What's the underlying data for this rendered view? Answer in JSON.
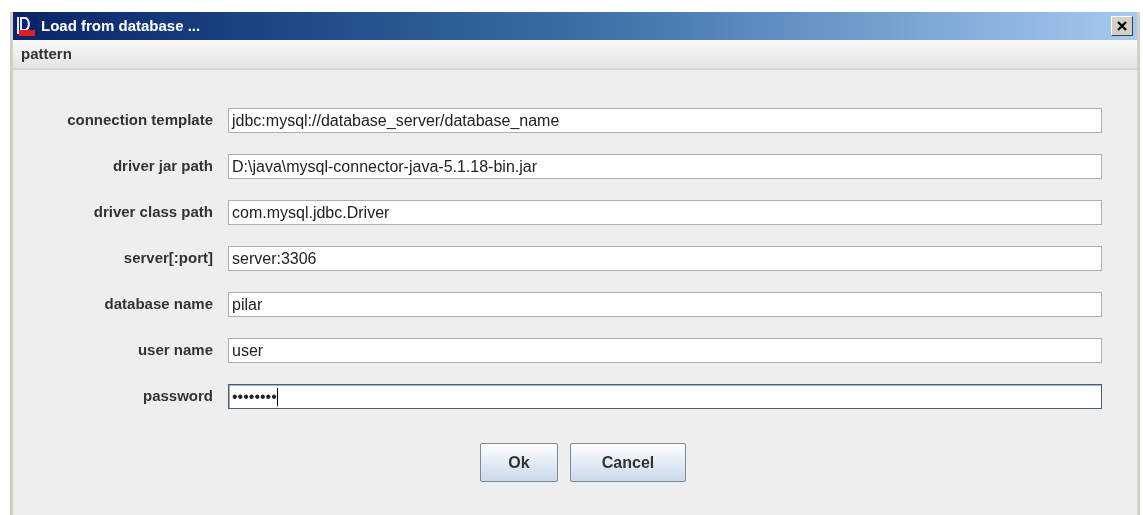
{
  "window": {
    "title": "Load from database ..."
  },
  "menu": [
    "pattern"
  ],
  "fields": [
    {
      "label": "connection template",
      "value": "jdbc:mysql://database_server/database_name",
      "focused": false
    },
    {
      "label": "driver jar path",
      "value": "D:\\java\\mysql-connector-java-5.1.18-bin.jar",
      "focused": false
    },
    {
      "label": "driver class path",
      "value": "com.mysql.jdbc.Driver",
      "focused": false
    },
    {
      "label": "server[:port]",
      "value": "server:3306",
      "focused": false
    },
    {
      "label": "database name",
      "value": "pilar",
      "focused": false
    },
    {
      "label": "user name",
      "value": "user",
      "focused": false
    },
    {
      "label": "password",
      "value": "••••••••",
      "focused": true
    }
  ],
  "buttons": [
    "Ok",
    "Cancel"
  ]
}
